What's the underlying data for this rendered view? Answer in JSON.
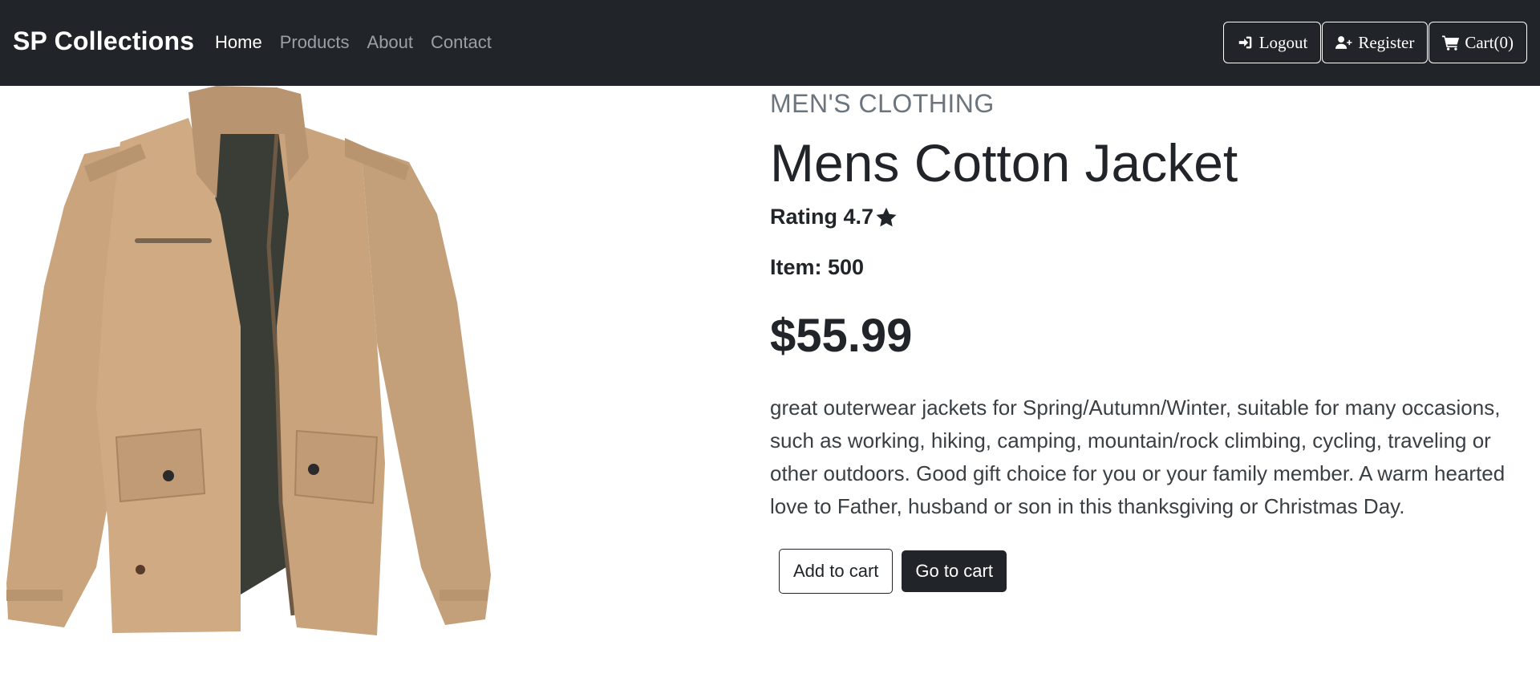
{
  "navbar": {
    "brand": "SP Collections",
    "links": [
      {
        "label": "Home",
        "active": true
      },
      {
        "label": "Products",
        "active": false
      },
      {
        "label": "About",
        "active": false
      },
      {
        "label": "Contact",
        "active": false
      }
    ],
    "actions": {
      "logout": {
        "label": "Logout",
        "icon": "sign-in-icon"
      },
      "register": {
        "label": "Register",
        "icon": "user-plus-icon"
      },
      "cart": {
        "label": "Cart(0)",
        "icon": "cart-icon"
      }
    }
  },
  "product": {
    "category": "MEN'S CLOTHING",
    "title": "Mens Cotton Jacket",
    "rating_label": "Rating 4.7",
    "item_label": "Item: 500",
    "price": "$55.99",
    "description": "great outerwear jackets for Spring/Autumn/Winter, suitable for many occasions, such as working, hiking, camping, mountain/rock climbing, cycling, traveling or other outdoors. Good gift choice for you or your family member. A warm hearted love to Father, husband or son in this thanksgiving or Christmas Day.",
    "image": "khaki-cotton-jacket",
    "image_colors": {
      "fabric": "#c9a47d",
      "lining": "#3a3d36"
    }
  },
  "buttons": {
    "add_to_cart": "Add to cart",
    "go_to_cart": "Go to cart"
  }
}
